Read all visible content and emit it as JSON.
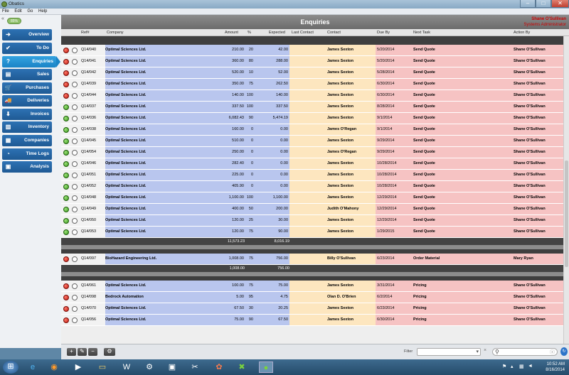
{
  "app": {
    "title": "Obatics"
  },
  "menu": [
    "File",
    "Edit",
    "Go",
    "Help"
  ],
  "sidebar": {
    "collapse_label": "«",
    "progress_label": "85%",
    "items": [
      {
        "label": "Overview",
        "icon": "arrow-right-icon",
        "glyph": "➔"
      },
      {
        "label": "To Do",
        "icon": "checkmark-icon",
        "glyph": "✔"
      },
      {
        "label": "Enquiries",
        "icon": "question-icon",
        "glyph": "?"
      },
      {
        "label": "Sales",
        "icon": "sales-icon",
        "glyph": "▤"
      },
      {
        "label": "Purchases",
        "icon": "cart-icon",
        "glyph": "🛒"
      },
      {
        "label": "Deliveries",
        "icon": "truck-icon",
        "glyph": "🚚"
      },
      {
        "label": "Invoices",
        "icon": "download-icon",
        "glyph": "⬇"
      },
      {
        "label": "Inventory",
        "icon": "bar-chart-icon",
        "glyph": "▥"
      },
      {
        "label": "Companies",
        "icon": "companies-icon",
        "glyph": "▦"
      },
      {
        "label": "Time Logs",
        "icon": "clock-icon",
        "glyph": "◔"
      },
      {
        "label": "Analysis",
        "icon": "analysis-icon",
        "glyph": "▣"
      }
    ]
  },
  "header": {
    "title": "Enquiries",
    "user": "Shane O'Sullivan",
    "role": "Systems Administrator"
  },
  "columns": {
    "ref": "Ref#",
    "company": "Company",
    "amount": "Amount",
    "pct": "%",
    "expected": "Expected",
    "last_contact": "Last Contact",
    "contact": "Contact",
    "due_by": "Due By",
    "next_task": "Next Task",
    "action_by": "Action By"
  },
  "groups": [
    {
      "rows": [
        {
          "status": "red",
          "ref": "Q14/040",
          "company": "Optimal Sciences Ltd.",
          "amount": "210.00",
          "pct": "20",
          "expected": "42.00",
          "contact": "James Sexton",
          "due": "5/20/2014",
          "task": "Send Quote",
          "action": "Shane O'Sullivan"
        },
        {
          "status": "red",
          "ref": "Q14/041",
          "company": "Optimal Sciences Ltd.",
          "amount": "360.00",
          "pct": "80",
          "expected": "288.00",
          "contact": "James Sexton",
          "due": "5/20/2014",
          "task": "Send Quote",
          "action": "Shane O'Sullivan"
        },
        {
          "status": "red",
          "ref": "Q14/042",
          "company": "Optimal Sciences Ltd.",
          "amount": "520.00",
          "pct": "10",
          "expected": "52.00",
          "contact": "James Sexton",
          "due": "5/28/2014",
          "task": "Send Quote",
          "action": "Shane O'Sullivan"
        },
        {
          "status": "red",
          "ref": "Q14/039",
          "company": "Optimal Sciences Ltd.",
          "amount": "350.00",
          "pct": "75",
          "expected": "262.50",
          "contact": "James Sexton",
          "due": "6/30/2014",
          "task": "Send Quote",
          "action": "Shane O'Sullivan"
        },
        {
          "status": "red",
          "ref": "Q14/044",
          "company": "Optimal Sciences Ltd.",
          "amount": "140.00",
          "pct": "100",
          "expected": "140.00",
          "contact": "James Sexton",
          "due": "6/30/2014",
          "task": "Send Quote",
          "action": "Shane O'Sullivan"
        },
        {
          "status": "green",
          "ref": "Q14/037",
          "company": "Optimal Sciences Ltd.",
          "amount": "337.50",
          "pct": "100",
          "expected": "337.50",
          "contact": "James Sexton",
          "due": "8/28/2014",
          "task": "Send Quote",
          "action": "Shane O'Sullivan"
        },
        {
          "status": "green",
          "ref": "Q14/036",
          "company": "Optimal Sciences Ltd.",
          "amount": "6,082.43",
          "pct": "90",
          "expected": "5,474.19",
          "contact": "James Sexton",
          "due": "9/1/2014",
          "task": "Send Quote",
          "action": "Shane O'Sullivan"
        },
        {
          "status": "green",
          "ref": "Q14/038",
          "company": "Optimal Sciences Ltd.",
          "amount": "160.00",
          "pct": "0",
          "expected": "0.00",
          "contact": "James O'Regan",
          "due": "9/1/2014",
          "task": "Send Quote",
          "action": "Shane O'Sullivan"
        },
        {
          "status": "green",
          "ref": "Q14/045",
          "company": "Optimal Sciences Ltd.",
          "amount": "510.00",
          "pct": "0",
          "expected": "0.00",
          "contact": "James Sexton",
          "due": "9/29/2014",
          "task": "Send Quote",
          "action": "Shane O'Sullivan"
        },
        {
          "status": "green",
          "ref": "Q14/054",
          "company": "Optimal Sciences Ltd.",
          "amount": "250.00",
          "pct": "0",
          "expected": "0.00",
          "contact": "James O'Regan",
          "due": "9/29/2014",
          "task": "Send Quote",
          "action": "Shane O'Sullivan"
        },
        {
          "status": "green",
          "ref": "Q14/046",
          "company": "Optimal Sciences Ltd.",
          "amount": "282.40",
          "pct": "0",
          "expected": "0.00",
          "contact": "James Sexton",
          "due": "10/28/2014",
          "task": "Send Quote",
          "action": "Shane O'Sullivan"
        },
        {
          "status": "green",
          "ref": "Q14/051",
          "company": "Optimal Sciences Ltd.",
          "amount": "225.00",
          "pct": "0",
          "expected": "0.00",
          "contact": "James Sexton",
          "due": "10/28/2014",
          "task": "Send Quote",
          "action": "Shane O'Sullivan"
        },
        {
          "status": "green",
          "ref": "Q14/052",
          "company": "Optimal Sciences Ltd.",
          "amount": "405.90",
          "pct": "0",
          "expected": "0.00",
          "contact": "James Sexton",
          "due": "10/28/2014",
          "task": "Send Quote",
          "action": "Shane O'Sullivan"
        },
        {
          "status": "green",
          "ref": "Q14/048",
          "company": "Optimal Sciences Ltd.",
          "amount": "1,100.00",
          "pct": "100",
          "expected": "1,100.00",
          "contact": "James Sexton",
          "due": "12/29/2014",
          "task": "Send Quote",
          "action": "Shane O'Sullivan"
        },
        {
          "status": "green",
          "ref": "Q14/049",
          "company": "Optimal Sciences Ltd.",
          "amount": "400.00",
          "pct": "50",
          "expected": "200.00",
          "contact": "Judith O'Mahony",
          "due": "12/29/2014",
          "task": "Send Quote",
          "action": "Shane O'Sullivan"
        },
        {
          "status": "green",
          "ref": "Q14/050",
          "company": "Optimal Sciences Ltd.",
          "amount": "120.00",
          "pct": "25",
          "expected": "30.00",
          "contact": "James Sexton",
          "due": "12/29/2014",
          "task": "Send Quote",
          "action": "Shane O'Sullivan"
        },
        {
          "status": "green",
          "ref": "Q14/053",
          "company": "Optimal Sciences Ltd.",
          "amount": "120.00",
          "pct": "75",
          "expected": "90.00",
          "contact": "James Sexton",
          "due": "1/29/2015",
          "task": "Send Quote",
          "action": "Shane O'Sullivan"
        }
      ],
      "total_amount": "11,573.23",
      "total_expected": "8,016.19"
    },
    {
      "rows": [
        {
          "status": "red",
          "ref": "Q14/097",
          "company": "BioHazard Engineering Ltd.",
          "amount": "1,008.00",
          "pct": "75",
          "expected": "756.00",
          "contact": "Billy O'Sullivan",
          "due": "6/23/2014",
          "task": "Order Material",
          "action": "Mary Ryan"
        }
      ],
      "total_amount": "1,008.00",
      "total_expected": "756.00"
    },
    {
      "rows": [
        {
          "status": "red",
          "ref": "Q14/061",
          "company": "Optimal Sciences Ltd.",
          "amount": "100.00",
          "pct": "75",
          "expected": "75.00",
          "contact": "James Sexton",
          "due": "3/31/2014",
          "task": "Pricing",
          "action": "Shane O'Sullivan"
        },
        {
          "status": "red",
          "ref": "Q14/098",
          "company": "Bedrock Automation",
          "amount": "5.00",
          "pct": "95",
          "expected": "4.75",
          "contact": "Olan D. O'Brien",
          "due": "6/2/2014",
          "task": "Pricing",
          "action": "Shane O'Sullivan"
        },
        {
          "status": "red",
          "ref": "Q14/070",
          "company": "Optimal Sciences Ltd.",
          "amount": "67.50",
          "pct": "30",
          "expected": "20.25",
          "contact": "James Sexton",
          "due": "6/23/2014",
          "task": "Pricing",
          "action": "Shane O'Sullivan"
        },
        {
          "status": "red",
          "ref": "Q14/056",
          "company": "Optimal Sciences Ltd.",
          "amount": "75.00",
          "pct": "90",
          "expected": "67.50",
          "contact": "James Sexton",
          "due": "6/30/2014",
          "task": "Pricing",
          "action": "Shane O'Sullivan"
        }
      ]
    }
  ],
  "bottom": {
    "add": "+",
    "edit": "✎",
    "remove": "−",
    "settings": "⚙",
    "filter_label": "Filter",
    "search_icon": "⚲"
  },
  "taskbar": {
    "time": "10:52 AM",
    "date": "8/16/2014"
  },
  "colors": {
    "accent": "#1f5a94",
    "active": "#1a84c6",
    "red_status": "#c01a10",
    "green_status": "#3b9a1e"
  }
}
